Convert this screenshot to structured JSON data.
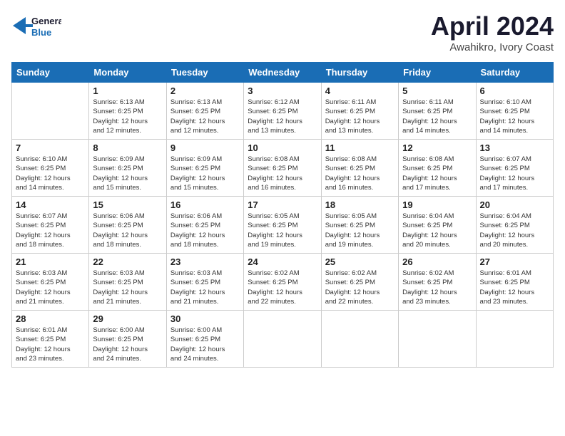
{
  "logo": {
    "line1": "General",
    "line2": "Blue"
  },
  "title": "April 2024",
  "subtitle": "Awahikro, Ivory Coast",
  "headers": [
    "Sunday",
    "Monday",
    "Tuesday",
    "Wednesday",
    "Thursday",
    "Friday",
    "Saturday"
  ],
  "weeks": [
    [
      {
        "day": "",
        "info": ""
      },
      {
        "day": "1",
        "info": "Sunrise: 6:13 AM\nSunset: 6:25 PM\nDaylight: 12 hours\nand 12 minutes."
      },
      {
        "day": "2",
        "info": "Sunrise: 6:13 AM\nSunset: 6:25 PM\nDaylight: 12 hours\nand 12 minutes."
      },
      {
        "day": "3",
        "info": "Sunrise: 6:12 AM\nSunset: 6:25 PM\nDaylight: 12 hours\nand 13 minutes."
      },
      {
        "day": "4",
        "info": "Sunrise: 6:11 AM\nSunset: 6:25 PM\nDaylight: 12 hours\nand 13 minutes."
      },
      {
        "day": "5",
        "info": "Sunrise: 6:11 AM\nSunset: 6:25 PM\nDaylight: 12 hours\nand 14 minutes."
      },
      {
        "day": "6",
        "info": "Sunrise: 6:10 AM\nSunset: 6:25 PM\nDaylight: 12 hours\nand 14 minutes."
      }
    ],
    [
      {
        "day": "7",
        "info": "Sunrise: 6:10 AM\nSunset: 6:25 PM\nDaylight: 12 hours\nand 14 minutes."
      },
      {
        "day": "8",
        "info": "Sunrise: 6:09 AM\nSunset: 6:25 PM\nDaylight: 12 hours\nand 15 minutes."
      },
      {
        "day": "9",
        "info": "Sunrise: 6:09 AM\nSunset: 6:25 PM\nDaylight: 12 hours\nand 15 minutes."
      },
      {
        "day": "10",
        "info": "Sunrise: 6:08 AM\nSunset: 6:25 PM\nDaylight: 12 hours\nand 16 minutes."
      },
      {
        "day": "11",
        "info": "Sunrise: 6:08 AM\nSunset: 6:25 PM\nDaylight: 12 hours\nand 16 minutes."
      },
      {
        "day": "12",
        "info": "Sunrise: 6:08 AM\nSunset: 6:25 PM\nDaylight: 12 hours\nand 17 minutes."
      },
      {
        "day": "13",
        "info": "Sunrise: 6:07 AM\nSunset: 6:25 PM\nDaylight: 12 hours\nand 17 minutes."
      }
    ],
    [
      {
        "day": "14",
        "info": "Sunrise: 6:07 AM\nSunset: 6:25 PM\nDaylight: 12 hours\nand 18 minutes."
      },
      {
        "day": "15",
        "info": "Sunrise: 6:06 AM\nSunset: 6:25 PM\nDaylight: 12 hours\nand 18 minutes."
      },
      {
        "day": "16",
        "info": "Sunrise: 6:06 AM\nSunset: 6:25 PM\nDaylight: 12 hours\nand 18 minutes."
      },
      {
        "day": "17",
        "info": "Sunrise: 6:05 AM\nSunset: 6:25 PM\nDaylight: 12 hours\nand 19 minutes."
      },
      {
        "day": "18",
        "info": "Sunrise: 6:05 AM\nSunset: 6:25 PM\nDaylight: 12 hours\nand 19 minutes."
      },
      {
        "day": "19",
        "info": "Sunrise: 6:04 AM\nSunset: 6:25 PM\nDaylight: 12 hours\nand 20 minutes."
      },
      {
        "day": "20",
        "info": "Sunrise: 6:04 AM\nSunset: 6:25 PM\nDaylight: 12 hours\nand 20 minutes."
      }
    ],
    [
      {
        "day": "21",
        "info": "Sunrise: 6:03 AM\nSunset: 6:25 PM\nDaylight: 12 hours\nand 21 minutes."
      },
      {
        "day": "22",
        "info": "Sunrise: 6:03 AM\nSunset: 6:25 PM\nDaylight: 12 hours\nand 21 minutes."
      },
      {
        "day": "23",
        "info": "Sunrise: 6:03 AM\nSunset: 6:25 PM\nDaylight: 12 hours\nand 21 minutes."
      },
      {
        "day": "24",
        "info": "Sunrise: 6:02 AM\nSunset: 6:25 PM\nDaylight: 12 hours\nand 22 minutes."
      },
      {
        "day": "25",
        "info": "Sunrise: 6:02 AM\nSunset: 6:25 PM\nDaylight: 12 hours\nand 22 minutes."
      },
      {
        "day": "26",
        "info": "Sunrise: 6:02 AM\nSunset: 6:25 PM\nDaylight: 12 hours\nand 23 minutes."
      },
      {
        "day": "27",
        "info": "Sunrise: 6:01 AM\nSunset: 6:25 PM\nDaylight: 12 hours\nand 23 minutes."
      }
    ],
    [
      {
        "day": "28",
        "info": "Sunrise: 6:01 AM\nSunset: 6:25 PM\nDaylight: 12 hours\nand 23 minutes."
      },
      {
        "day": "29",
        "info": "Sunrise: 6:00 AM\nSunset: 6:25 PM\nDaylight: 12 hours\nand 24 minutes."
      },
      {
        "day": "30",
        "info": "Sunrise: 6:00 AM\nSunset: 6:25 PM\nDaylight: 12 hours\nand 24 minutes."
      },
      {
        "day": "",
        "info": ""
      },
      {
        "day": "",
        "info": ""
      },
      {
        "day": "",
        "info": ""
      },
      {
        "day": "",
        "info": ""
      }
    ]
  ]
}
